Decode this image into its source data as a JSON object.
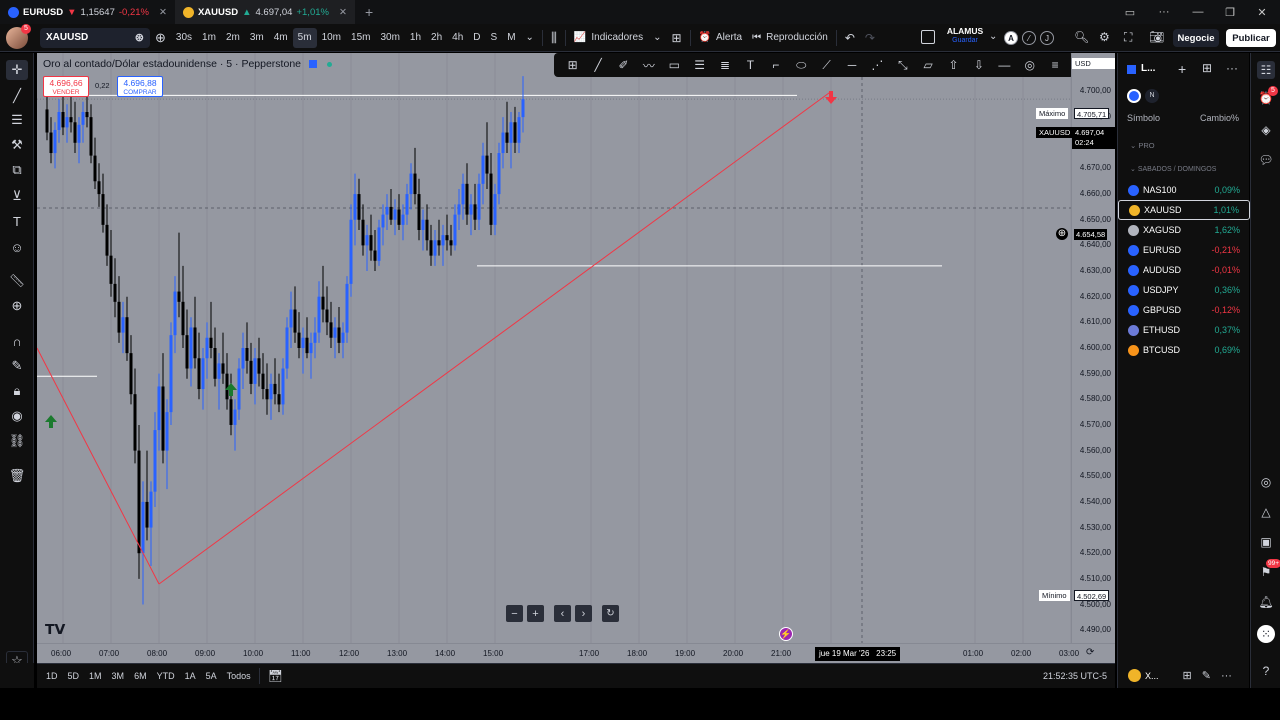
{
  "browser_tabs": [
    {
      "symbol": "EURUSD",
      "arrow": "▼",
      "price": "1,15647",
      "change": "-0,21%",
      "direction": "down",
      "favicon_color": "#2962ff"
    },
    {
      "symbol": "XAUUSD",
      "arrow": "▲",
      "price": "4.697,04",
      "change": "+1,01%",
      "direction": "up",
      "favicon_color": "#f0b429"
    }
  ],
  "toolbar": {
    "symbol": "XAUUSD",
    "intervals": [
      "30s",
      "1m",
      "2m",
      "3m",
      "4m",
      "5m",
      "10m",
      "15m",
      "30m",
      "1h",
      "2h",
      "4h",
      "D",
      "S",
      "M"
    ],
    "selected_interval": "5m",
    "indicators_label": "Indicadores",
    "alert_label": "Alerta",
    "replay_label": "Reproducción",
    "account_name": "ALAMUS",
    "account_sub": "Guardar",
    "trade_label": "Negocie",
    "publish_label": "Publicar",
    "letter_buttons": [
      "A",
      "⁄",
      "J"
    ]
  },
  "chart": {
    "title": "Oro al contado/Dólar estadounidense · 5 · Pepperstone",
    "sell_price": "4.696,66",
    "sell_label": "VENDER",
    "spread": "0,22",
    "buy_price": "4.696,88",
    "buy_label": "COMPRAR",
    "currency": "USD",
    "max_label": "Máximo",
    "max_value": "4.705,71",
    "min_label": "Mínimo",
    "min_value": "4.502,69",
    "symbol_tag": "XAUUSD",
    "current_price": "4.697,04",
    "countdown": "02:24",
    "crosshair_price": "4.654,58",
    "crosshair_time": "jue 19 Mar '26   23:25",
    "price_ticks": [
      "4.710,00",
      "4.700,00",
      "4.690,00",
      "4.680,00",
      "4.670,00",
      "4.660,00",
      "4.650,00",
      "4.640,00",
      "4.630,00",
      "4.620,00",
      "4.610,00",
      "4.600,00",
      "4.590,00",
      "4.580,00",
      "4.570,00",
      "4.560,00",
      "4.550,00",
      "4.540,00",
      "4.530,00",
      "4.520,00",
      "4.510,00",
      "4.500,00",
      "4.490,00"
    ],
    "time_ticks": [
      "06:00",
      "07:00",
      "08:00",
      "09:00",
      "10:00",
      "11:00",
      "12:00",
      "13:00",
      "14:00",
      "15:00",
      "17:00",
      "18:00",
      "19:00",
      "20:00",
      "21:00",
      "22:00",
      "01:00",
      "02:00",
      "03:00"
    ],
    "colors": {
      "background": "#9598a1",
      "up": "#2962ff",
      "down": "#000000",
      "trendline": "#f23645",
      "levels": "#ffffff"
    }
  },
  "chart_data": {
    "type": "candlestick",
    "title": "Oro al contado/Dólar estadounidense · 5 · Pepperstone",
    "xlabel": "",
    "ylabel": "",
    "x_start": "05:40",
    "x_step_minutes": 5,
    "ylim": [
      4485,
      4715
    ],
    "ohlc": [
      [
        4693,
        4700,
        4681,
        4684
      ],
      [
        4684,
        4690,
        4672,
        4676
      ],
      [
        4676,
        4688,
        4670,
        4685
      ],
      [
        4685,
        4697,
        4680,
        4692
      ],
      [
        4692,
        4698,
        4683,
        4686
      ],
      [
        4686,
        4695,
        4680,
        4690
      ],
      [
        4690,
        4699,
        4684,
        4688
      ],
      [
        4688,
        4696,
        4676,
        4680
      ],
      [
        4680,
        4690,
        4672,
        4687
      ],
      [
        4687,
        4696,
        4680,
        4692
      ],
      [
        4692,
        4699,
        4686,
        4690
      ],
      [
        4690,
        4695,
        4672,
        4675
      ],
      [
        4675,
        4682,
        4662,
        4665
      ],
      [
        4665,
        4672,
        4655,
        4660
      ],
      [
        4660,
        4668,
        4645,
        4648
      ],
      [
        4648,
        4656,
        4632,
        4636
      ],
      [
        4636,
        4646,
        4620,
        4625
      ],
      [
        4625,
        4635,
        4612,
        4618
      ],
      [
        4618,
        4628,
        4602,
        4606
      ],
      [
        4606,
        4618,
        4598,
        4612
      ],
      [
        4612,
        4620,
        4595,
        4598
      ],
      [
        4598,
        4605,
        4578,
        4582
      ],
      [
        4582,
        4592,
        4555,
        4560
      ],
      [
        4560,
        4570,
        4510,
        4520
      ],
      [
        4520,
        4548,
        4500,
        4540
      ],
      [
        4540,
        4560,
        4525,
        4530
      ],
      [
        4530,
        4548,
        4515,
        4544
      ],
      [
        4544,
        4575,
        4538,
        4568
      ],
      [
        4568,
        4590,
        4560,
        4585
      ],
      [
        4585,
        4598,
        4555,
        4560
      ],
      [
        4560,
        4580,
        4545,
        4575
      ],
      [
        4575,
        4610,
        4570,
        4605
      ],
      [
        4605,
        4628,
        4598,
        4622
      ],
      [
        4622,
        4645,
        4612,
        4618
      ],
      [
        4618,
        4632,
        4600,
        4605
      ],
      [
        4605,
        4615,
        4588,
        4592
      ],
      [
        4592,
        4612,
        4585,
        4608
      ],
      [
        4608,
        4620,
        4592,
        4596
      ],
      [
        4596,
        4606,
        4580,
        4584
      ],
      [
        4584,
        4600,
        4576,
        4596
      ],
      [
        4596,
        4610,
        4588,
        4604
      ],
      [
        4604,
        4618,
        4596,
        4600
      ],
      [
        4600,
        4608,
        4585,
        4588
      ],
      [
        4588,
        4598,
        4576,
        4594
      ],
      [
        4594,
        4606,
        4586,
        4590
      ],
      [
        4590,
        4598,
        4576,
        4580
      ],
      [
        4580,
        4590,
        4566,
        4570
      ],
      [
        4570,
        4580,
        4560,
        4576
      ],
      [
        4576,
        4596,
        4572,
        4592
      ],
      [
        4592,
        4606,
        4584,
        4600
      ],
      [
        4600,
        4610,
        4590,
        4595
      ],
      [
        4595,
        4602,
        4582,
        4586
      ],
      [
        4586,
        4600,
        4578,
        4596
      ],
      [
        4596,
        4604,
        4585,
        4590
      ],
      [
        4590,
        4598,
        4580,
        4584
      ],
      [
        4584,
        4594,
        4574,
        4580
      ],
      [
        4580,
        4590,
        4572,
        4586
      ],
      [
        4586,
        4596,
        4578,
        4582
      ],
      [
        4582,
        4590,
        4575,
        4578
      ],
      [
        4578,
        4596,
        4574,
        4592
      ],
      [
        4592,
        4612,
        4588,
        4608
      ],
      [
        4608,
        4622,
        4600,
        4615
      ],
      [
        4615,
        4624,
        4602,
        4606
      ],
      [
        4606,
        4614,
        4596,
        4600
      ],
      [
        4600,
        4608,
        4590,
        4604
      ],
      [
        4604,
        4612,
        4596,
        4598
      ],
      [
        4598,
        4606,
        4588,
        4602
      ],
      [
        4602,
        4612,
        4596,
        4606
      ],
      [
        4606,
        4626,
        4602,
        4620
      ],
      [
        4620,
        4632,
        4610,
        4615
      ],
      [
        4615,
        4624,
        4605,
        4610
      ],
      [
        4610,
        4618,
        4600,
        4604
      ],
      [
        4604,
        4612,
        4596,
        4608
      ],
      [
        4608,
        4616,
        4598,
        4602
      ],
      [
        4602,
        4610,
        4596,
        4606
      ],
      [
        4606,
        4628,
        4602,
        4625
      ],
      [
        4625,
        4656,
        4620,
        4650
      ],
      [
        4650,
        4668,
        4640,
        4660
      ],
      [
        4660,
        4666,
        4646,
        4650
      ],
      [
        4650,
        4656,
        4636,
        4640
      ],
      [
        4640,
        4648,
        4630,
        4644
      ],
      [
        4644,
        4652,
        4634,
        4638
      ],
      [
        4638,
        4646,
        4630,
        4634
      ],
      [
        4634,
        4650,
        4632,
        4647
      ],
      [
        4647,
        4656,
        4640,
        4652
      ],
      [
        4652,
        4660,
        4646,
        4655
      ],
      [
        4655,
        4662,
        4648,
        4650
      ],
      [
        4650,
        4658,
        4644,
        4654
      ],
      [
        4654,
        4660,
        4646,
        4648
      ],
      [
        4648,
        4656,
        4642,
        4652
      ],
      [
        4652,
        4664,
        4648,
        4660
      ],
      [
        4660,
        4672,
        4654,
        4668
      ],
      [
        4668,
        4678,
        4656,
        4660
      ],
      [
        4660,
        4666,
        4642,
        4646
      ],
      [
        4646,
        4654,
        4638,
        4650
      ],
      [
        4650,
        4656,
        4638,
        4642
      ],
      [
        4642,
        4648,
        4632,
        4636
      ],
      [
        4636,
        4646,
        4632,
        4642
      ],
      [
        4642,
        4650,
        4636,
        4640
      ],
      [
        4640,
        4648,
        4632,
        4644
      ],
      [
        4644,
        4652,
        4638,
        4642
      ],
      [
        4642,
        4648,
        4636,
        4640
      ],
      [
        4640,
        4656,
        4638,
        4652
      ],
      [
        4652,
        4662,
        4646,
        4656
      ],
      [
        4656,
        4668,
        4650,
        4664
      ],
      [
        4664,
        4672,
        4648,
        4652
      ],
      [
        4652,
        4660,
        4644,
        4656
      ],
      [
        4656,
        4664,
        4646,
        4650
      ],
      [
        4650,
        4668,
        4646,
        4664
      ],
      [
        4664,
        4680,
        4656,
        4675
      ],
      [
        4675,
        4688,
        4662,
        4668
      ],
      [
        4668,
        4676,
        4644,
        4648
      ],
      [
        4648,
        4664,
        4644,
        4660
      ],
      [
        4660,
        4680,
        4656,
        4676
      ],
      [
        4676,
        4690,
        4670,
        4684
      ],
      [
        4684,
        4696,
        4676,
        4680
      ],
      [
        4680,
        4692,
        4670,
        4688
      ],
      [
        4688,
        4694,
        4676,
        4680
      ],
      [
        4680,
        4692,
        4676,
        4690
      ],
      [
        4690,
        4706,
        4684,
        4697
      ]
    ],
    "annotations": {
      "resistance": 4698.5,
      "support": 4632,
      "trendline": [
        [
          "08:00",
          4508
        ],
        [
          "22:00",
          4700
        ]
      ],
      "markers": [
        {
          "time": "09:30",
          "type": "up-arrow"
        },
        {
          "time": "05:45",
          "type": "up-arrow"
        },
        {
          "time": "22:00",
          "type": "down-arrow"
        }
      ]
    }
  },
  "bottom_ranges": [
    "1D",
    "5D",
    "1M",
    "3M",
    "6M",
    "YTD",
    "1A",
    "5A",
    "Todos"
  ],
  "clock": "21:52:35 UTC-5",
  "watchlist": {
    "title": "L...",
    "col_symbol": "Símbolo",
    "col_change": "Cambio%",
    "section1": "PRO",
    "section2": "SABADOS / DOMINGOS",
    "rows": [
      {
        "symbol": "NAS100",
        "change": "0,09%",
        "dir": "up",
        "color": "#2962ff"
      },
      {
        "symbol": "XAUUSD",
        "change": "1,01%",
        "dir": "up",
        "color": "#f0b429"
      },
      {
        "symbol": "XAGUSD",
        "change": "1,62%",
        "dir": "up",
        "color": "#b2b5be"
      },
      {
        "symbol": "EURUSD",
        "change": "-0,21%",
        "dir": "down",
        "color": "#2962ff"
      },
      {
        "symbol": "AUDUSD",
        "change": "-0,01%",
        "dir": "down",
        "color": "#2962ff"
      },
      {
        "symbol": "USDJPY",
        "change": "0,36%",
        "dir": "up",
        "color": "#2962ff"
      },
      {
        "symbol": "GBPUSD",
        "change": "-0,12%",
        "dir": "down",
        "color": "#2962ff"
      },
      {
        "symbol": "ETHUSD",
        "change": "0,37%",
        "dir": "up",
        "color": "#6c7bd8"
      },
      {
        "symbol": "BTCUSD",
        "change": "0,69%",
        "dir": "up",
        "color": "#f7931a"
      }
    ],
    "footer_label": "X..."
  },
  "badges": {
    "avatar": "5",
    "right_top": "5",
    "right_notif": "99+"
  }
}
